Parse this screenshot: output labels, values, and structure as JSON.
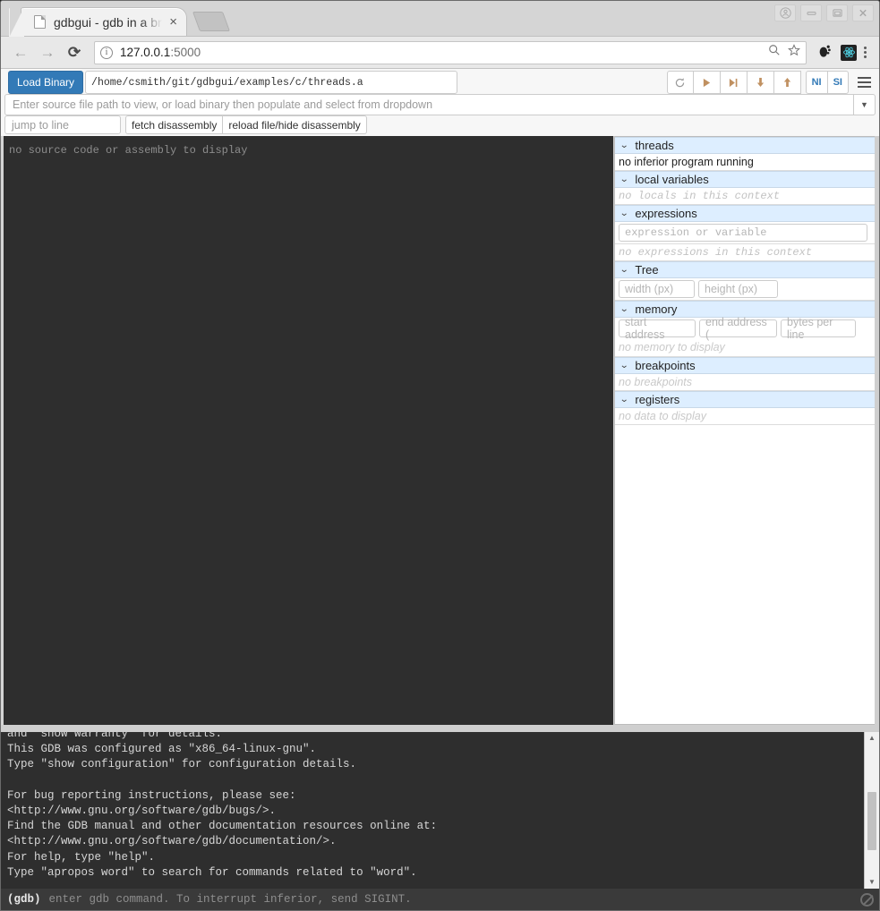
{
  "browser": {
    "tab": {
      "title": "gdbgui - gdb in a bro",
      "close_label": "×",
      "favicon": "page-icon"
    },
    "new_tab_label": "",
    "window_controls": {
      "profile": "user-avatar",
      "minimize": "–",
      "maximize": "□",
      "close": "✕"
    },
    "nav": {
      "back": "←",
      "forward": "→",
      "reload": "⟳"
    },
    "omnibox": {
      "info_glyph": "i",
      "url_host": "127.0.0.1",
      "url_port": ":5000",
      "zoom_glyph": "🔍",
      "bookmark_glyph": "☆"
    },
    "extensions": [
      {
        "name": "gnome-foot-icon"
      },
      {
        "name": "react-devtools-icon"
      }
    ],
    "menu_label": "chrome-menu"
  },
  "app": {
    "toolbar": {
      "load_binary_label": "Load Binary",
      "binary_path": "/home/csmith/git/gdbgui/examples/c/threads.a",
      "controls": [
        {
          "name": "restart-button",
          "glyph": "⟳"
        },
        {
          "name": "continue-button",
          "glyph": "▶"
        },
        {
          "name": "next-button",
          "glyph": "▶|"
        },
        {
          "name": "step-into-button",
          "glyph": "↓"
        },
        {
          "name": "step-out-button",
          "glyph": "↑"
        }
      ],
      "next_instruction_label": "NI",
      "step_instruction_label": "SI",
      "menu_label": "settings-menu"
    },
    "source_select": {
      "placeholder": "Enter source file path to view, or load binary then populate and select from dropdown",
      "value": "",
      "caret": "▼"
    },
    "jump_row": {
      "jump_placeholder": "jump to line",
      "jump_value": "",
      "fetch_disassembly_label": "fetch disassembly",
      "reload_label": "reload file/hide disassembly"
    },
    "source_pane": {
      "message": "no source code or assembly to display"
    },
    "right_panel": {
      "sections": [
        {
          "name": "threads",
          "title": "threads",
          "caret": "⌄",
          "body_text": "no inferior program running",
          "body_style": "normal"
        },
        {
          "name": "local-variables",
          "title": "local variables",
          "caret": "⌄",
          "body_text": "no locals in this context",
          "body_style": "mono-empty"
        },
        {
          "name": "expressions",
          "title": "expressions",
          "caret": "⌄",
          "input_placeholder": "expression or variable",
          "input_value": "",
          "body_text": "no expressions in this context",
          "body_style": "mono-empty"
        },
        {
          "name": "tree",
          "title": "Tree",
          "caret": "⌄",
          "fields": [
            {
              "name": "tree-width-input",
              "placeholder": "width (px)",
              "value": ""
            },
            {
              "name": "tree-height-input",
              "placeholder": "height (px)",
              "value": ""
            }
          ]
        },
        {
          "name": "memory",
          "title": "memory",
          "caret": "⌄",
          "fields": [
            {
              "name": "memory-start-address-input",
              "placeholder": "start address",
              "value": ""
            },
            {
              "name": "memory-end-address-input",
              "placeholder": "end address (",
              "value": ""
            },
            {
              "name": "memory-bytes-per-line-input",
              "placeholder": "bytes per line",
              "value": ""
            }
          ],
          "body_text": "no memory to display",
          "body_style": "sans-empty"
        },
        {
          "name": "breakpoints",
          "title": "breakpoints",
          "caret": "⌄",
          "body_text": "no breakpoints",
          "body_style": "sans-empty"
        },
        {
          "name": "registers",
          "title": "registers",
          "caret": "⌄",
          "body_text": "no data to display",
          "body_style": "sans-empty"
        }
      ]
    },
    "console": {
      "lines": [
        "and \"show warranty\" for details.",
        "This GDB was configured as \"x86_64-linux-gnu\".",
        "Type \"show configuration\" for configuration details.",
        "",
        "For bug reporting instructions, please see:",
        "<http://www.gnu.org/software/gdb/bugs/>.",
        "Find the GDB manual and other documentation resources online at:",
        "<http://www.gnu.org/software/gdb/documentation/>.",
        "For help, type \"help\".",
        "Type \"apropos word\" to search for commands related to \"word\"."
      ],
      "prompt_label": "(gdb)",
      "prompt_placeholder": "enter gdb command. To interrupt inferior, send SIGINT.",
      "prompt_value": "",
      "scroll_up": "▲",
      "scroll_down": "▼",
      "clear_icon": "no-entry-icon"
    }
  },
  "colors": {
    "accent_blue": "#337ab7",
    "section_header": "#ddeeff",
    "console_bg": "#2e2e2e",
    "source_bg": "#2e2e2e"
  }
}
